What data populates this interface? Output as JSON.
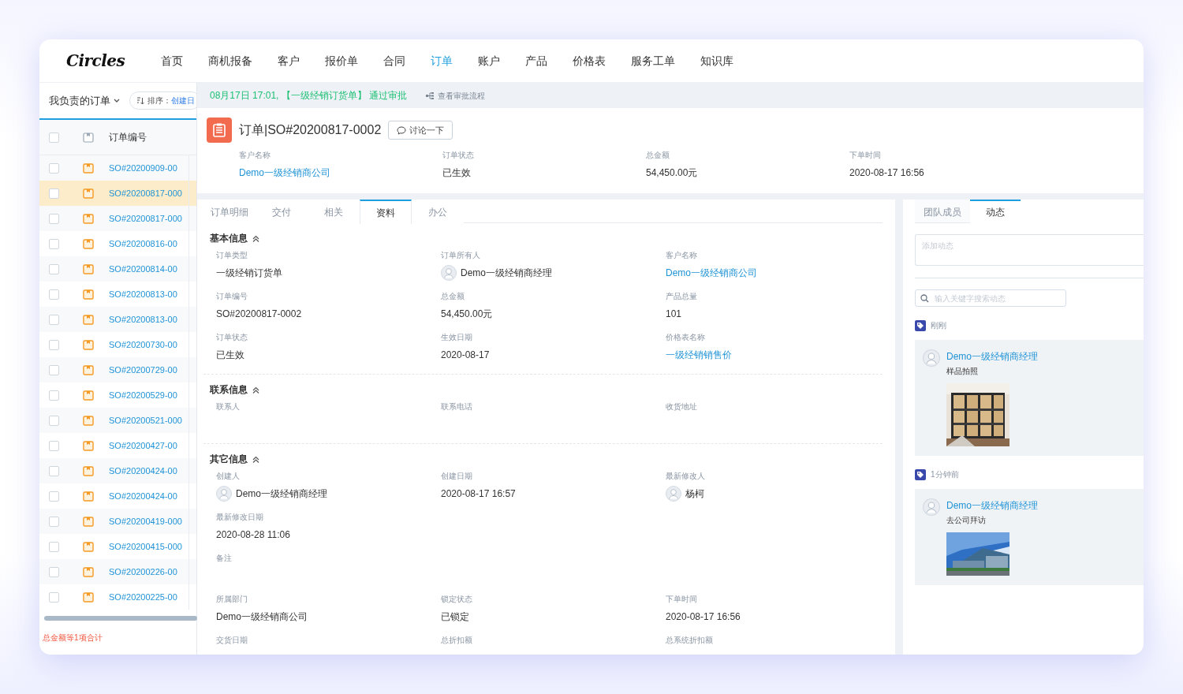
{
  "app": {
    "logo": "Circles"
  },
  "nav": [
    {
      "label": "首页",
      "selected": false
    },
    {
      "label": "商机报备",
      "selected": false
    },
    {
      "label": "客户",
      "selected": false
    },
    {
      "label": "报价单",
      "selected": false
    },
    {
      "label": "合同",
      "selected": false
    },
    {
      "label": "订单",
      "selected": true
    },
    {
      "label": "账户",
      "selected": false
    },
    {
      "label": "产品",
      "selected": false
    },
    {
      "label": "价格表",
      "selected": false
    },
    {
      "label": "服务工单",
      "selected": false
    },
    {
      "label": "知识库",
      "selected": false
    }
  ],
  "list": {
    "view": "我负责的订单",
    "sort_label": "排序：",
    "sort_value": "创建日",
    "select_all": {
      "checked": false
    },
    "column": "订单编号",
    "footer": "总金额等1项合计",
    "rows": [
      {
        "number": "SO#20200909-00",
        "checked": false,
        "selected": false
      },
      {
        "number": "SO#20200817-000",
        "checked": false,
        "selected": true
      },
      {
        "number": "SO#20200817-000",
        "checked": false,
        "selected": false
      },
      {
        "number": "SO#20200816-00",
        "checked": false,
        "selected": false
      },
      {
        "number": "SO#20200814-00",
        "checked": false,
        "selected": false
      },
      {
        "number": "SO#20200813-00",
        "checked": false,
        "selected": false
      },
      {
        "number": "SO#20200813-00",
        "checked": false,
        "selected": false
      },
      {
        "number": "SO#20200730-00",
        "checked": false,
        "selected": false
      },
      {
        "number": "SO#20200729-00",
        "checked": false,
        "selected": false
      },
      {
        "number": "SO#20200529-00",
        "checked": false,
        "selected": false
      },
      {
        "number": "SO#20200521-000",
        "checked": false,
        "selected": false
      },
      {
        "number": "SO#20200427-00",
        "checked": false,
        "selected": false
      },
      {
        "number": "SO#20200424-00",
        "checked": false,
        "selected": false
      },
      {
        "number": "SO#20200424-00",
        "checked": false,
        "selected": false
      },
      {
        "number": "SO#20200419-000",
        "checked": false,
        "selected": false
      },
      {
        "number": "SO#20200415-000",
        "checked": false,
        "selected": false
      },
      {
        "number": "SO#20200226-00",
        "checked": false,
        "selected": false
      },
      {
        "number": "SO#20200225-00",
        "checked": false,
        "selected": false
      }
    ]
  },
  "approval": {
    "message": "08月17日 17:01, 【一级经销订货单】 通过审批",
    "link": "查看审批流程"
  },
  "order": {
    "title": "订单|SO#20200817-0002",
    "discuss_button": "讨论一下",
    "summary": [
      {
        "label": "客户名称",
        "value": "Demo一级经销商公司",
        "kind": "link"
      },
      {
        "label": "订单状态",
        "value": "已生效",
        "kind": "text"
      },
      {
        "label": "总金额",
        "value": "54,450.00元",
        "kind": "text"
      },
      {
        "label": "下单时间",
        "value": "2020-08-17 16:56",
        "kind": "text"
      }
    ]
  },
  "tabs": [
    {
      "label": "订单明细",
      "selected": false
    },
    {
      "label": "交付",
      "selected": false
    },
    {
      "label": "相关",
      "selected": false
    },
    {
      "label": "资料",
      "selected": true
    },
    {
      "label": "办公",
      "selected": false
    }
  ],
  "sections": [
    {
      "title": "基本信息",
      "expanded": true,
      "rows": [
        [
          {
            "label": "订单类型",
            "value": "一级经销订货单",
            "kind": "text"
          },
          {
            "label": "订单所有人",
            "value": "Demo一级经销商经理",
            "kind": "person"
          },
          {
            "label": "客户名称",
            "value": "Demo一级经销商公司",
            "kind": "link"
          }
        ],
        [
          {
            "label": "订单编号",
            "value": "SO#20200817-0002",
            "kind": "text"
          },
          {
            "label": "总金额",
            "value": "54,450.00元",
            "kind": "text"
          },
          {
            "label": "产品总量",
            "value": "101",
            "kind": "text"
          }
        ],
        [
          {
            "label": "订单状态",
            "value": "已生效",
            "kind": "text"
          },
          {
            "label": "生效日期",
            "value": "2020-08-17",
            "kind": "text"
          },
          {
            "label": "价格表名称",
            "value": "一级经销销售价",
            "kind": "link"
          }
        ]
      ]
    },
    {
      "title": "联系信息",
      "expanded": true,
      "rows": [
        [
          {
            "label": "联系人",
            "kind": "text"
          },
          {
            "label": "联系电话",
            "kind": "text"
          },
          {
            "label": "收货地址",
            "kind": "text"
          }
        ]
      ]
    },
    {
      "title": "其它信息",
      "expanded": true,
      "rows": [
        [
          {
            "label": "创建人",
            "value": "Demo一级经销商经理",
            "kind": "person"
          },
          {
            "label": "创建日期",
            "value": "2020-08-17 16:57",
            "kind": "text"
          },
          {
            "label": "最新修改人",
            "value": "杨柯",
            "kind": "person"
          }
        ],
        [
          {
            "label": "最新修改日期",
            "value": "2020-08-28 11:06",
            "kind": "text"
          }
        ],
        [
          {
            "label": "备注",
            "kind": "text"
          }
        ],
        [
          {
            "label": "所属部门",
            "value": "Demo一级经销商公司",
            "kind": "text"
          },
          {
            "label": "锁定状态",
            "value": "已锁定",
            "kind": "text"
          },
          {
            "label": "下单时间",
            "value": "2020-08-17 16:56",
            "kind": "text"
          }
        ],
        [
          {
            "label": "交货日期",
            "kind": "text"
          },
          {
            "label": "总折扣额",
            "kind": "text"
          },
          {
            "label": "总系统折扣额",
            "kind": "text"
          }
        ]
      ]
    }
  ],
  "activity": {
    "tabs": [
      {
        "label": "团队成员",
        "selected": false
      },
      {
        "label": "动态",
        "selected": true
      }
    ],
    "input": {
      "placeholder": "添加动态"
    },
    "search": {
      "placeholder": "输入关键字搜索动态"
    },
    "entries": [
      {
        "time": "刚刚",
        "author": "Demo一级经销商经理",
        "text": "样品拍照"
      },
      {
        "time": "1分钟前",
        "author": "Demo一级经销商经理",
        "text": "去公司拜访"
      }
    ]
  }
}
